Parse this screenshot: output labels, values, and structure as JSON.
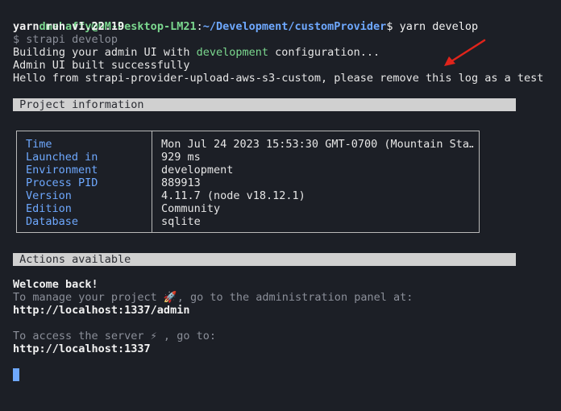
{
  "prompt": {
    "user_host": "dmehaffy@DM-Desktop-LM21",
    "separator": ":",
    "path": "~/Development/customProvider",
    "symbol": "$",
    "command": " yarn develop"
  },
  "output": {
    "yarn_version": "yarn run v1.22.19",
    "run_cmd": "$ strapi develop",
    "build_prefix": "Building your admin UI with ",
    "build_env": "development",
    "build_suffix": " configuration...",
    "built": "Admin UI built successfully",
    "hello": "Hello from strapi-provider-upload-aws-s3-custom, please remove this log as a test"
  },
  "project_info": {
    "header": " Project information",
    "rows": [
      {
        "key": "Time",
        "value": "Mon Jul 24 2023 15:53:30 GMT-0700 (Mountain Sta…"
      },
      {
        "key": "Launched in",
        "value": "929 ms"
      },
      {
        "key": "Environment",
        "value": "development"
      },
      {
        "key": "Process PID",
        "value": "889913"
      },
      {
        "key": "Version",
        "value": "4.11.7 (node v18.12.1)"
      },
      {
        "key": "Edition",
        "value": "Community"
      },
      {
        "key": "Database",
        "value": "sqlite"
      }
    ]
  },
  "actions": {
    "header": " Actions available",
    "welcome": "Welcome back!",
    "manage_text": "To manage your project 🚀, go to the administration panel at:",
    "admin_url": "http://localhost:1337/admin",
    "server_text": "To access the server ⚡ , go to:",
    "server_url": "http://localhost:1337"
  },
  "colors": {
    "background": "#1c1f26",
    "green": "#7bd88f",
    "blue": "#6ea8fe",
    "arrow": "#e0241b",
    "bar": "#d0d0d0"
  }
}
